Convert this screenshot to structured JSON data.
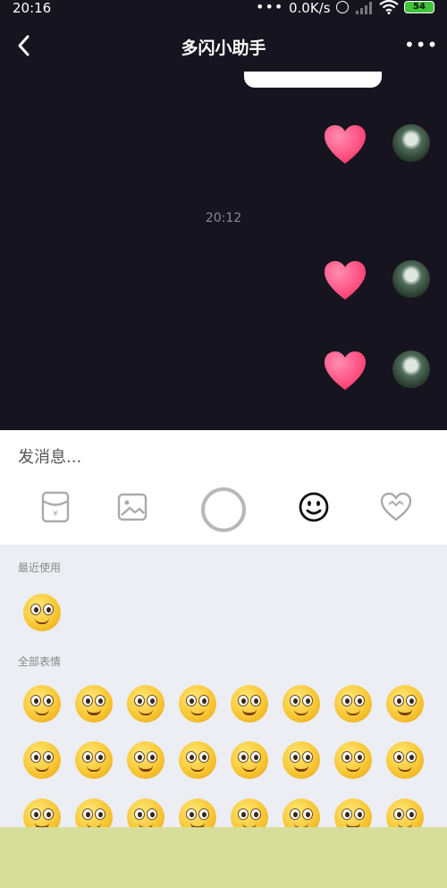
{
  "status_bar": {
    "time": "20:16",
    "dots": "•••",
    "speed": "0.0K/s",
    "battery": "54"
  },
  "header": {
    "title": "多闪小助手",
    "more": "•••"
  },
  "chat": {
    "timestamp": "20:12",
    "messages": [
      {
        "type": "heart-sticker",
        "sender": "me"
      },
      {
        "type": "heart-sticker",
        "sender": "me"
      },
      {
        "type": "heart-sticker",
        "sender": "me"
      }
    ]
  },
  "composer": {
    "placeholder": "发消息...",
    "toolbar": [
      "red-packet-icon",
      "image-icon",
      "record-button",
      "emoji-icon",
      "heart-sticker-icon"
    ]
  },
  "emoji_panel": {
    "recent_label": "最近使用",
    "all_label": "全部表情"
  },
  "colors": {
    "chat_bg": "#16141f",
    "heart": "#ff4f7e",
    "panel_bg": "#eceef4"
  }
}
